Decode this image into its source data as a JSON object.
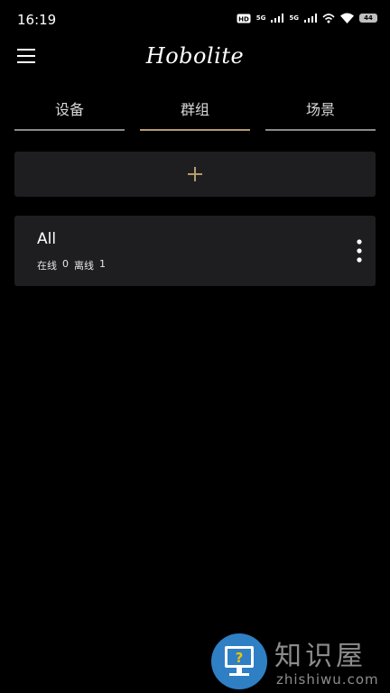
{
  "status_bar": {
    "time": "16:19",
    "network_1": "5G",
    "network_2": "5G",
    "battery": "44"
  },
  "header": {
    "logo_text": "Hobolite",
    "menu_icon": "hamburger-menu-icon"
  },
  "tabs": [
    {
      "label": "设备",
      "active": false
    },
    {
      "label": "群组",
      "active": true
    },
    {
      "label": "场景",
      "active": false
    }
  ],
  "add_group": {
    "icon": "plus-icon"
  },
  "groups": [
    {
      "name": "All",
      "online_label": "在线",
      "online_count": "0",
      "offline_label": "离线",
      "offline_count": "1"
    }
  ],
  "colors": {
    "background": "#000000",
    "card": "#1e1e20",
    "accent_gold": "#b59a6d",
    "tab_line": "#8a8a8a"
  },
  "watermark": {
    "title": "知识屋",
    "subtitle": "zhishiwu.com"
  }
}
